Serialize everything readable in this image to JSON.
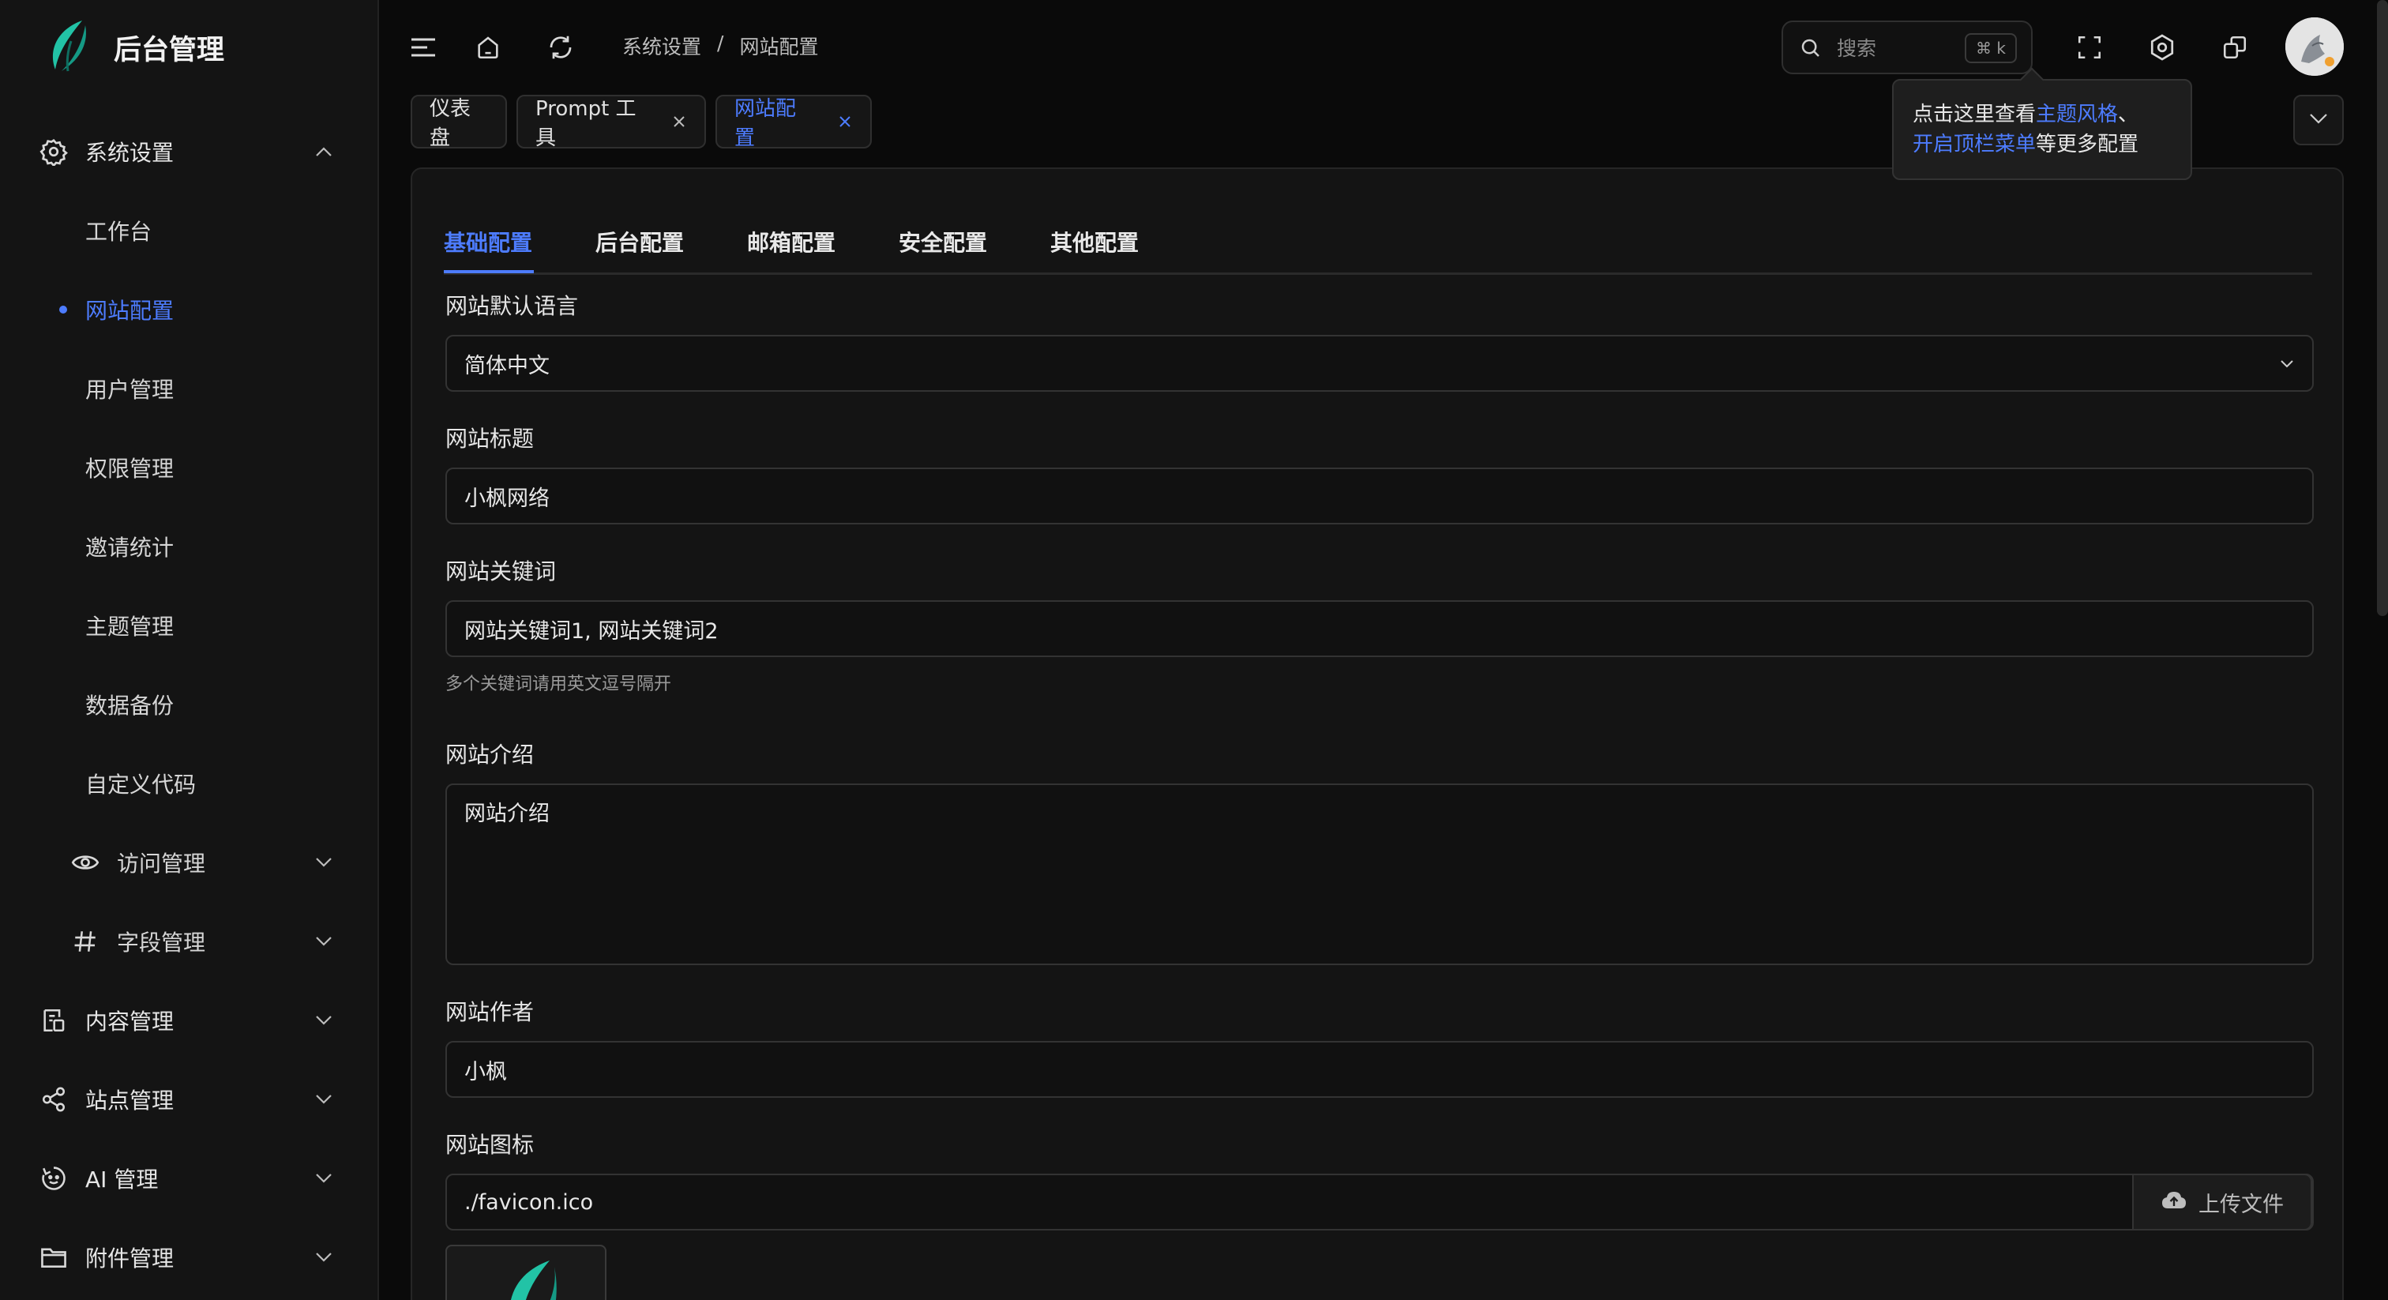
{
  "app": {
    "title": "后台管理"
  },
  "sidebar": {
    "items": [
      {
        "label": "系统设置",
        "icon": "gear-icon",
        "expanded": true
      },
      {
        "label": "工作台"
      },
      {
        "label": "网站配置",
        "active": true
      },
      {
        "label": "用户管理"
      },
      {
        "label": "权限管理"
      },
      {
        "label": "邀请统计"
      },
      {
        "label": "主题管理"
      },
      {
        "label": "数据备份"
      },
      {
        "label": "自定义代码"
      },
      {
        "label": "访问管理",
        "icon": "eye-icon"
      },
      {
        "label": "字段管理",
        "icon": "hash-icon"
      },
      {
        "label": "内容管理",
        "icon": "document-icon"
      },
      {
        "label": "站点管理",
        "icon": "share-icon"
      },
      {
        "label": "AI 管理",
        "icon": "ai-icon"
      },
      {
        "label": "附件管理",
        "icon": "folder-icon"
      }
    ]
  },
  "topbar": {
    "breadcrumb": [
      "系统设置",
      "/",
      "网站配置"
    ],
    "search": {
      "placeholder": "搜索",
      "shortcut": "⌘ k"
    }
  },
  "tabs": [
    {
      "label": "仪表盘"
    },
    {
      "label": "Prompt 工具"
    },
    {
      "label": "网站配置",
      "active": true
    }
  ],
  "tooltip": {
    "t1": "点击这里查看",
    "link1": "主题风格",
    "t2": "、",
    "link2": "开启顶栏菜单",
    "t3": "等更多配置"
  },
  "content_tabs": [
    "基础配置",
    "后台配置",
    "邮箱配置",
    "安全配置",
    "其他配置"
  ],
  "form": {
    "lang": {
      "label": "网站默认语言",
      "value": "简体中文"
    },
    "title": {
      "label": "网站标题",
      "value": "小枫网络"
    },
    "keywords": {
      "label": "网站关键词",
      "value": "网站关键词1, 网站关键词2",
      "hint": "多个关键词请用英文逗号隔开"
    },
    "intro": {
      "label": "网站介绍",
      "value": "网站介绍"
    },
    "author": {
      "label": "网站作者",
      "value": "小枫"
    },
    "icon": {
      "label": "网站图标",
      "value": "./favicon.ico",
      "upload": "上传文件"
    }
  },
  "colors": {
    "accent": "#4d7cff",
    "bg": "#0a0a0a",
    "panel": "#141414",
    "logo_teal": "#22c3a6"
  }
}
